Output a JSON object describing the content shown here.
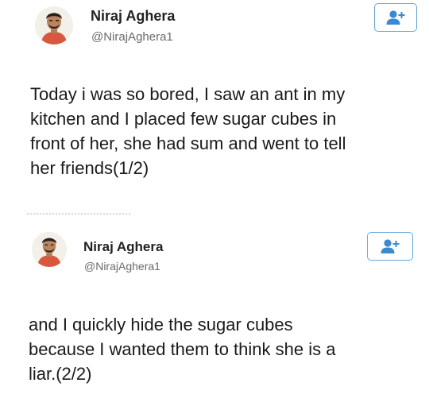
{
  "tweets": [
    {
      "author_name": "Niraj Aghera",
      "handle": "@NirajAghera1",
      "text": "Today i was so bored, I saw an ant in my\nkitchen and I placed few sugar cubes in\nfront of her, she had sum and went to tell\nher friends(1/2)",
      "follow_icon": "add-user-icon"
    },
    {
      "author_name": "Niraj Aghera",
      "handle": "@NirajAghera1",
      "text": "and I quickly hide the sugar cubes\nbecause I wanted them to think she is a\nliar.(2/2)",
      "follow_icon": "add-user-icon"
    }
  ],
  "colors": {
    "follow_button_border": "#6aa8d8",
    "follow_icon": "#3b8ad0",
    "handle_text": "#6a6a6a"
  }
}
